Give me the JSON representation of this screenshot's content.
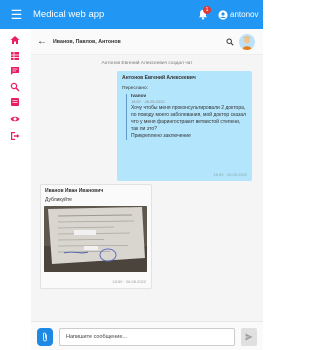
{
  "appbar": {
    "title": "Medical web app",
    "notification_count": "1",
    "username": "antonov",
    "color": "#2196f3"
  },
  "sidebar": {
    "items": [
      {
        "icon": "home-icon"
      },
      {
        "icon": "grid-icon"
      },
      {
        "icon": "chat-icon"
      },
      {
        "icon": "search-icon"
      },
      {
        "icon": "document-icon"
      },
      {
        "icon": "eye-icon"
      },
      {
        "icon": "logout-icon"
      }
    ],
    "icon_color": "#e91e63"
  },
  "chat": {
    "title": "Иванов, Павлов, Антонов",
    "system_message": "Антонов Евгений Алексеевич создал чат",
    "messages": [
      {
        "sender": "Антонов Евгений Алексеевич",
        "forwarded_label": "Переслано:",
        "forwarded": {
          "name": "Ivanov",
          "time": "18:57 · 26.05.2022",
          "text": "Хочу чтобы меня проконсультировали 2 доктора, по поводу моего заболевания, мой доктор сказал что у меня фарингостракит ветвистой степени, так ли это?",
          "extra": "Прикреплено заключение"
        },
        "time": "18:59 · 26.05.2022"
      },
      {
        "sender": "Иванов Иван Иванович",
        "subtitle": "Дубликуйте",
        "time": "18:59 · 26.05.2022"
      }
    ]
  },
  "composer": {
    "placeholder": "Напишите сообщение..."
  }
}
